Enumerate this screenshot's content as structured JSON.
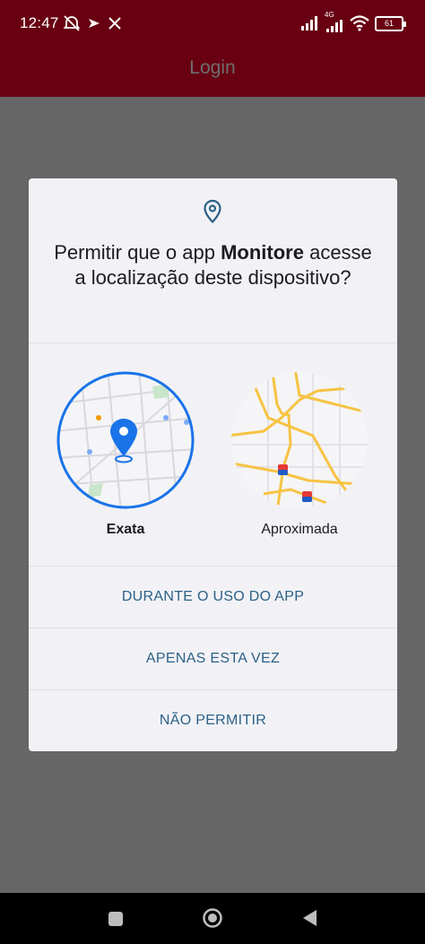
{
  "status_bar": {
    "time": "12:47",
    "network_label": "4G",
    "battery_level": "61",
    "icons_left": [
      "alarm-off-icon",
      "vpn-key-icon",
      "x-app-icon"
    ],
    "icons_right": [
      "signal-icon",
      "signal-4g-icon",
      "wifi-icon",
      "battery-icon"
    ]
  },
  "app_bar": {
    "title": "Login"
  },
  "dialog": {
    "icon": "location-pin-icon",
    "title_pre": "Permitir que o app ",
    "title_app": "Monitore",
    "title_post": " acesse a localização deste dispositivo?",
    "options": [
      {
        "label": "Exata",
        "selected": true
      },
      {
        "label": "Aproximada",
        "selected": false
      }
    ],
    "actions": {
      "while_using": "DURANTE O USO DO APP",
      "only_this_time": "APENAS ESTA VEZ",
      "deny": "NÃO PERMITIR"
    }
  },
  "colors": {
    "app_bar": "#680012",
    "accent": "#1a73e8",
    "action_text": "#2b6186",
    "dialog_bg": "#f2f2f6",
    "scrim": "#666666"
  },
  "nav_bar": {
    "buttons": [
      "recent-apps-icon",
      "home-icon",
      "back-icon"
    ]
  }
}
